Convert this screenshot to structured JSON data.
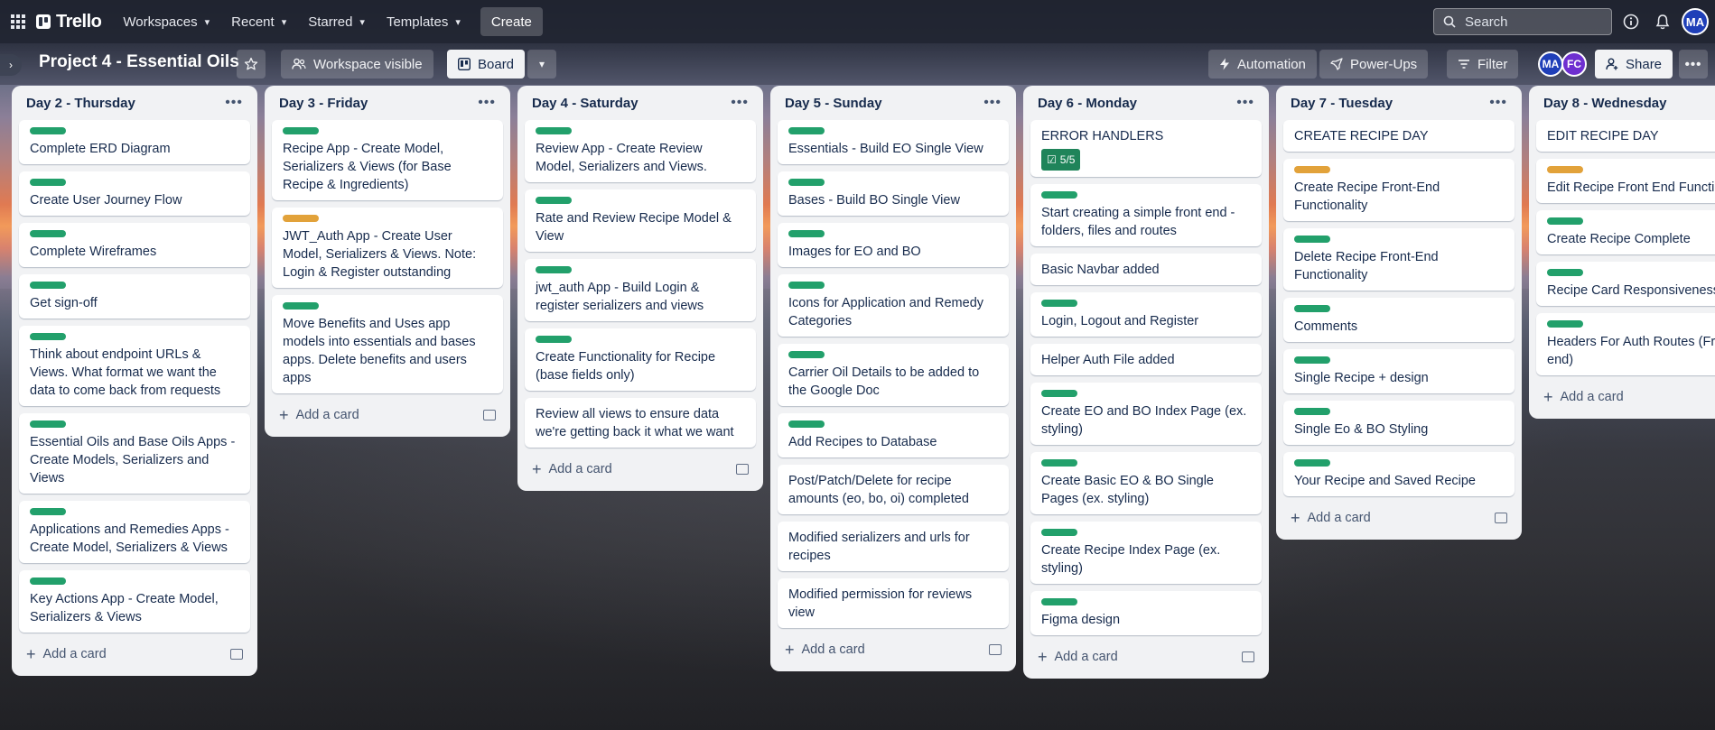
{
  "app": "Trello",
  "nav": {
    "items": [
      {
        "label": "Workspaces"
      },
      {
        "label": "Recent"
      },
      {
        "label": "Starred"
      },
      {
        "label": "Templates"
      }
    ],
    "create_label": "Create",
    "search_placeholder": "Search",
    "avatar": "MA"
  },
  "board": {
    "title": "Project 4 - Essential Oils",
    "visibility_label": "Workspace visible",
    "view_label": "Board",
    "automation_label": "Automation",
    "powerups_label": "Power-Ups",
    "filter_label": "Filter",
    "members": [
      "MA",
      "FC"
    ],
    "share_label": "Share"
  },
  "colors": {
    "green_label": "#22a06b",
    "orange_label": "#e2a23a",
    "checklist_badge": "#1f845a",
    "avatar_blue": "#1f3fb8",
    "avatar_purple": "#6e2fd0"
  },
  "add_card_label": "Add a card",
  "lists": [
    {
      "title": "Day 2 - Thursday",
      "cards": [
        {
          "label": "green",
          "text": "Complete ERD Diagram"
        },
        {
          "label": "green",
          "text": "Create User Journey Flow"
        },
        {
          "label": "green",
          "text": "Complete Wireframes"
        },
        {
          "label": "green",
          "text": "Get sign-off"
        },
        {
          "label": "green",
          "text": "Think about endpoint URLs & Views. What format we want the data to come back from requests"
        },
        {
          "label": "green",
          "text": "Essential Oils and Base Oils Apps - Create Models, Serializers and Views"
        },
        {
          "label": "green",
          "text": "Applications and Remedies Apps - Create Model, Serializers & Views"
        },
        {
          "label": "green",
          "text": "Key Actions App - Create Model, Serializers & Views"
        }
      ]
    },
    {
      "title": "Day 3 - Friday",
      "cards": [
        {
          "label": "green",
          "text": "Recipe App - Create Model, Serializers & Views (for Base Recipe & Ingredients)"
        },
        {
          "label": "orange",
          "text": "JWT_Auth App - Create User Model, Serializers & Views. Note: Login & Register outstanding"
        },
        {
          "label": "green",
          "text": "Move Benefits and Uses app models into essentials and bases apps. Delete benefits and users apps"
        }
      ]
    },
    {
      "title": "Day 4 - Saturday",
      "cards": [
        {
          "label": "green",
          "text": "Review App - Create Review Model, Serializers and Views."
        },
        {
          "label": "green",
          "text": "Rate and Review Recipe Model & View"
        },
        {
          "label": "green",
          "text": "jwt_auth App - Build Login & register serializers and views"
        },
        {
          "label": "green",
          "text": "Create Functionality for Recipe (base fields only)"
        },
        {
          "label": "",
          "text": "Review all views to ensure data we're getting back it what we want"
        }
      ]
    },
    {
      "title": "Day 5 - Sunday",
      "cards": [
        {
          "label": "green",
          "text": "Essentials - Build EO Single View"
        },
        {
          "label": "green",
          "text": "Bases - Build BO Single View"
        },
        {
          "label": "green",
          "text": "Images for EO and BO"
        },
        {
          "label": "green",
          "text": "Icons for Application and Remedy Categories"
        },
        {
          "label": "green",
          "text": "Carrier Oil Details to be added to the Google Doc"
        },
        {
          "label": "green",
          "text": "Add Recipes to Database"
        },
        {
          "label": "",
          "text": "Post/Patch/Delete for recipe amounts (eo, bo, oi) completed"
        },
        {
          "label": "",
          "text": "Modified serializers and urls for recipes"
        },
        {
          "label": "",
          "text": "Modified permission for reviews view"
        }
      ]
    },
    {
      "title": "Day 6 - Monday",
      "cards": [
        {
          "label": "",
          "text": "ERROR HANDLERS",
          "badge": "5/5"
        },
        {
          "label": "green",
          "text": "Start creating a simple front end - folders, files and routes"
        },
        {
          "label": "",
          "text": "Basic Navbar added"
        },
        {
          "label": "green",
          "text": "Login, Logout and Register"
        },
        {
          "label": "",
          "text": "Helper Auth File added"
        },
        {
          "label": "green",
          "text": "Create EO and BO Index Page (ex. styling)"
        },
        {
          "label": "green",
          "text": "Create Basic EO & BO Single Pages (ex. styling)"
        },
        {
          "label": "green",
          "text": "Create Recipe Index Page (ex. styling)"
        },
        {
          "label": "green",
          "text": "Figma design"
        }
      ]
    },
    {
      "title": "Day 7 - Tuesday",
      "cards": [
        {
          "label": "",
          "text": "CREATE RECIPE DAY"
        },
        {
          "label": "orange",
          "text": "Create Recipe Front-End Functionality"
        },
        {
          "label": "green",
          "text": "Delete Recipe Front-End Functionality"
        },
        {
          "label": "green",
          "text": "Comments"
        },
        {
          "label": "green",
          "text": "Single Recipe + design"
        },
        {
          "label": "green",
          "text": "Single Eo & BO Styling"
        },
        {
          "label": "green",
          "text": "Your Recipe and Saved Recipe"
        }
      ]
    },
    {
      "title": "Day 8 - Wednesday",
      "cards": [
        {
          "label": "",
          "text": "EDIT RECIPE DAY"
        },
        {
          "label": "orange",
          "text": "Edit Recipe Front End Functionality"
        },
        {
          "label": "green",
          "text": "Create Recipe Complete"
        },
        {
          "label": "green",
          "text": "Recipe Card Responsiveness"
        },
        {
          "label": "green",
          "text": "Headers For Auth Routes (Front-end)"
        }
      ]
    }
  ]
}
